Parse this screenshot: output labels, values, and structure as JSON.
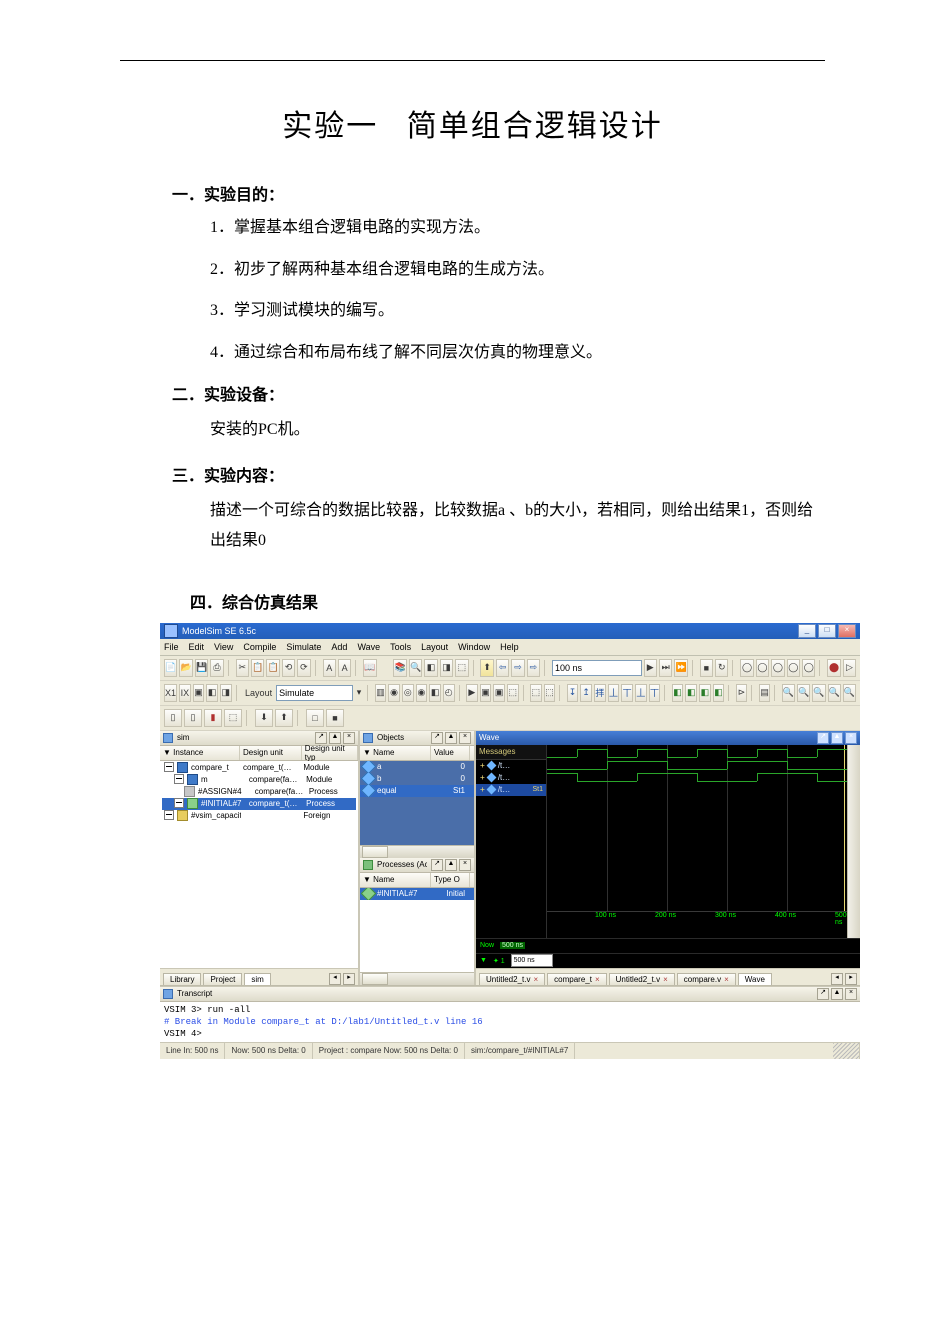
{
  "doc": {
    "title": "实验一   简单组合逻辑设计",
    "s1": {
      "head": "一．实验目的：",
      "i1": "1．掌握基本组合逻辑电路的实现方法。",
      "i2": "2．初步了解两种基本组合逻辑电路的生成方法。",
      "i3": "3．学习测试模块的编写。",
      "i4": "4．通过综合和布局布线了解不同层次仿真的物理意义。"
    },
    "s2": {
      "head": "二．实验设备：",
      "p": "安装的PC机。"
    },
    "s3": {
      "head": "三．实验内容：",
      "p": "描述一个可综合的数据比较器，比较数据a 、b的大小，若相同，则给出结果1，否则给出结果0"
    },
    "s4": {
      "head": "四．综合仿真结果"
    }
  },
  "shot": {
    "title": "ModelSim SE 6.5c",
    "win": {
      "min": "_",
      "max": "□",
      "close": "×"
    },
    "menu": [
      "File",
      "Edit",
      "View",
      "Compile",
      "Simulate",
      "Add",
      "Wave",
      "Tools",
      "Layout",
      "Window",
      "Help"
    ],
    "tb1": {
      "icons": [
        "📄",
        "📂",
        "💾",
        "⎙",
        "│",
        "✂",
        "📋",
        "📋",
        "⟲",
        "⟳",
        "│",
        "A",
        "A",
        "│",
        "📖"
      ],
      "mid": [
        "│",
        "📚",
        "🔍",
        "◧",
        "◨",
        "⬚",
        "│",
        "⬆",
        "⇦",
        "⇨",
        "⇨",
        "│"
      ],
      "time": "100 ns",
      "tail": [
        "│",
        "⬚",
        "⬚",
        "⬚",
        "│",
        "⊞",
        "◌",
        "◌",
        "◌",
        "◌",
        "◌",
        "│",
        "⚙",
        "▷"
      ]
    },
    "tb2": {
      "left": [
        "X1",
        "IX",
        "▣",
        "◧",
        "◨",
        "│"
      ],
      "layout_lbl": "Layout",
      "layout_val": "Simulate",
      "mid": [
        "│",
        "▥",
        "◉",
        "◎",
        "◉",
        "◧",
        "◴",
        "│",
        "▶",
        "▣",
        "▣",
        "⬚",
        "│",
        "⬚",
        "⬚"
      ],
      "grp2": [
        "│",
        "↧",
        "↥",
        "拝",
        "丄",
        "丅",
        "丄",
        "丅",
        "│",
        "◧",
        "◧",
        "◧",
        "◧",
        "│",
        "⊳",
        "│",
        "▤",
        "│",
        "🔍",
        "🔍",
        "🔍",
        "🔍",
        "🔍"
      ]
    },
    "tb3": {
      "left": [
        "▯",
        "▯",
        "▮",
        "⬚",
        "│",
        "⬇",
        "⬆",
        "│",
        "□",
        "■"
      ]
    },
    "ctrls": {
      "pop": "↗",
      "up": "▲",
      "x": "×"
    },
    "sim": {
      "title": "sim",
      "cols": [
        "▼ Instance",
        "Design unit",
        "Design unit typ"
      ],
      "rows": [
        {
          "inst": "compare_t",
          "du": "compare_t(…",
          "dut": "Module",
          "sel": false,
          "indent": 0,
          "icon": "blue"
        },
        {
          "inst": "m",
          "du": "compare(fa…",
          "dut": "Module",
          "sel": false,
          "indent": 1,
          "icon": "blue"
        },
        {
          "inst": "#ASSIGN#4",
          "du": "compare(fa…",
          "dut": "Process",
          "sel": false,
          "indent": 2,
          "icon": "gray"
        },
        {
          "inst": "#INITIAL#7",
          "du": "compare_t(…",
          "dut": "Process",
          "sel": true,
          "indent": 1,
          "icon": "green"
        },
        {
          "inst": "#vsim_capacity#",
          "du": "",
          "dut": "Foreign",
          "sel": false,
          "indent": 0,
          "icon": "yellow"
        }
      ],
      "tabs": [
        "Library",
        "Project",
        "sim"
      ]
    },
    "objects": {
      "title": "Objects",
      "cols": [
        "▼ Name",
        "Value"
      ],
      "rows": [
        {
          "name": "a",
          "val": "0",
          "sel": false
        },
        {
          "name": "b",
          "val": "0",
          "sel": false
        },
        {
          "name": "equal",
          "val": "St1",
          "sel": true
        }
      ]
    },
    "processes": {
      "title": "Processes (Active)",
      "cols": [
        "▼ Name",
        "Type O"
      ],
      "rows": [
        {
          "name": "#INITIAL#7",
          "type": "Initial",
          "sel": true
        }
      ]
    },
    "wave": {
      "title": "Wave",
      "msgcol": "Messages",
      "signals": [
        {
          "name": "/t…",
          "val": "",
          "sel": false
        },
        {
          "name": "/t…",
          "val": "",
          "sel": false
        },
        {
          "name": "/t…",
          "val": "St1",
          "sel": true
        }
      ],
      "now_lbl": "Now",
      "now_val": "500 ns",
      "cur_lbl": "▼",
      "cur_val": "500 ns",
      "ruler": [
        "100 ns",
        "200 ns",
        "300 ns",
        "400 ns",
        "500 ns"
      ],
      "tabs": [
        "Untitled2_t.v",
        "compare_t",
        "Untitled2_t.v",
        "compare.v",
        "Wave"
      ]
    },
    "transcript": {
      "title": "Transcript",
      "l1": "VSIM 3> run -all",
      "l2": "# Break in Module compare_t at D:/lab1/Untitled_t.v line 16",
      "l3": "VSIM 4>"
    },
    "status": {
      "c1": "Line In: 500 ns",
      "c2": "Now: 500 ns   Delta: 0",
      "c3": "Project : compare   Now: 500 ns   Delta: 0",
      "c4": "sim:/compare_t/#INITIAL#7"
    }
  }
}
